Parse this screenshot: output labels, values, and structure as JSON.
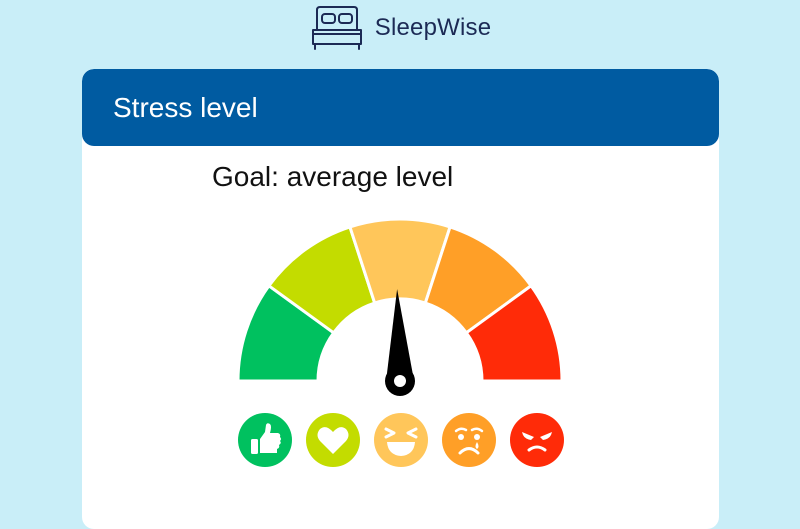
{
  "app": {
    "name": "SleepWise",
    "logo_icon": "bed-icon"
  },
  "card": {
    "title": "Stress level",
    "goal_text": "Goal: average level"
  },
  "gauge": {
    "segment_colors": [
      "#00c15f",
      "#c3dc00",
      "#ffc65a",
      "#ff9f27",
      "#ff2b08"
    ],
    "needle_color": "#000000",
    "needle_value": 0.49
  },
  "emojis": [
    {
      "icon": "thumbs-up-icon",
      "color": "#00c15f"
    },
    {
      "icon": "heart-icon",
      "color": "#c3dc00"
    },
    {
      "icon": "laughing-face-icon",
      "color": "#ffc65a"
    },
    {
      "icon": "crying-face-icon",
      "color": "#ff9f27"
    },
    {
      "icon": "angry-face-icon",
      "color": "#ff2b08"
    }
  ]
}
